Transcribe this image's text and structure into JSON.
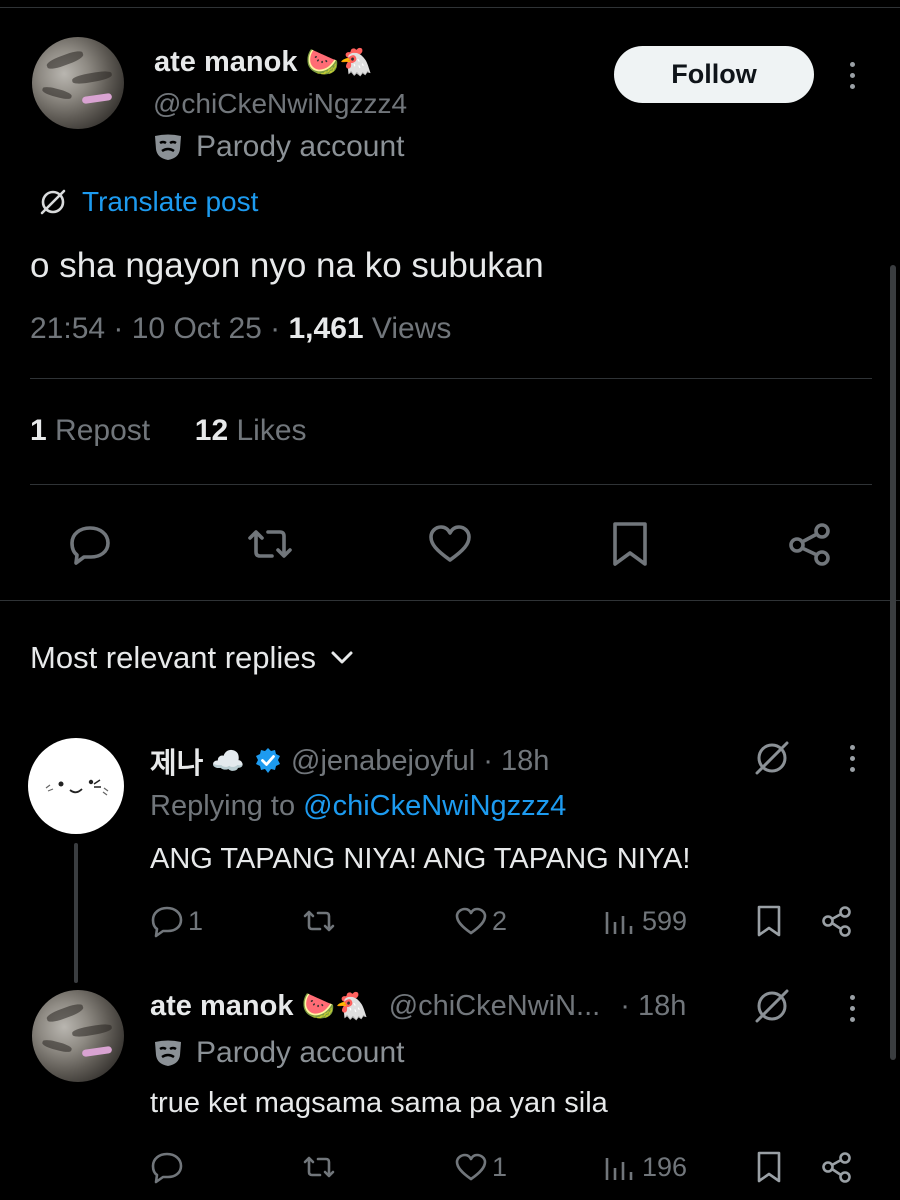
{
  "post": {
    "author": {
      "name": "ate manok",
      "emojis": "🍉🐔",
      "handle": "@chiCkeNwiNgzzz4",
      "badge": "Parody account"
    },
    "follow_label": "Follow",
    "translate_label": "Translate post",
    "text": "o sha ngayon nyo na ko subukan",
    "time": "21:54",
    "date": "10 Oct 25",
    "views_count": "1,461",
    "views_label": "Views",
    "reposts_count": "1",
    "reposts_label": "Repost",
    "likes_count": "12",
    "likes_label": "Likes"
  },
  "replies_header": {
    "label": "Most relevant replies"
  },
  "replies": [
    {
      "name": "제나",
      "name_emoji": "☁️",
      "verified": true,
      "handle": "@jenabejoyful",
      "age": "· 18h",
      "replying_prefix": "Replying to",
      "replying_handle": "@chiCkeNwiNgzzz4",
      "text": "ANG TAPANG NIYA! ANG TAPANG NIYA!",
      "reply_count": "1",
      "like_count": "2",
      "view_count": "599"
    },
    {
      "name": "ate manok",
      "name_emoji": "🍉🐔",
      "handle": "@chiCkeNwiN...",
      "age": "· 18h",
      "badge": "Parody account",
      "text": "true ket magsama sama pa yan sila",
      "reply_count": "",
      "like_count": "1",
      "view_count": "196"
    }
  ],
  "colors": {
    "background": "#000000",
    "text": "#e7e9ea",
    "secondary": "#71767b",
    "link": "#1d9bf0",
    "verified": "#1d9bf0"
  }
}
